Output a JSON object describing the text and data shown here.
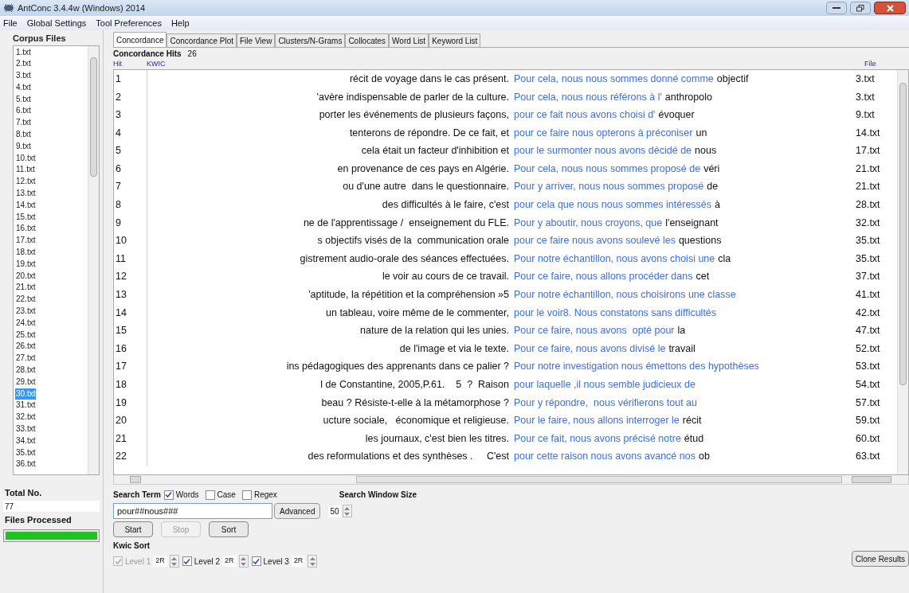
{
  "window": {
    "title": "AntConc 3.4.4w (Windows) 2014"
  },
  "menu": [
    "File",
    "Global Settings",
    "Tool Preferences",
    "Help"
  ],
  "corpus_files": {
    "title": "Corpus Files",
    "files": [
      {
        "name": "1.txt",
        "selected": false
      },
      {
        "name": "2.txt",
        "selected": false
      },
      {
        "name": "3.txt",
        "selected": false
      },
      {
        "name": "4.txt",
        "selected": false
      },
      {
        "name": "5.txt",
        "selected": false
      },
      {
        "name": "6.txt",
        "selected": false
      },
      {
        "name": "7.txt",
        "selected": false
      },
      {
        "name": "8.txt",
        "selected": false
      },
      {
        "name": "9.txt",
        "selected": false
      },
      {
        "name": "10.txt",
        "selected": false
      },
      {
        "name": "11.txt",
        "selected": false
      },
      {
        "name": "12.txt",
        "selected": false
      },
      {
        "name": "13.txt",
        "selected": false
      },
      {
        "name": "14.txt",
        "selected": false
      },
      {
        "name": "15.txt",
        "selected": false
      },
      {
        "name": "16.txt",
        "selected": false
      },
      {
        "name": "17.txt",
        "selected": false
      },
      {
        "name": "18.txt",
        "selected": false
      },
      {
        "name": "19.txt",
        "selected": false
      },
      {
        "name": "20.txt",
        "selected": false
      },
      {
        "name": "21.txt",
        "selected": false
      },
      {
        "name": "22.txt",
        "selected": false
      },
      {
        "name": "23.txt",
        "selected": false
      },
      {
        "name": "24.txt",
        "selected": false
      },
      {
        "name": "25.txt",
        "selected": false
      },
      {
        "name": "26.txt",
        "selected": false
      },
      {
        "name": "27.txt",
        "selected": false
      },
      {
        "name": "28.txt",
        "selected": false
      },
      {
        "name": "29.txt",
        "selected": false
      },
      {
        "name": "30.txt",
        "selected": true
      },
      {
        "name": "31.txt",
        "selected": false
      },
      {
        "name": "32.txt",
        "selected": false
      },
      {
        "name": "33.txt",
        "selected": false
      },
      {
        "name": "34.txt",
        "selected": false
      },
      {
        "name": "35.txt",
        "selected": false
      },
      {
        "name": "36.txt",
        "selected": false
      }
    ]
  },
  "total": {
    "label": "Total No.",
    "value": "77"
  },
  "files_processed": {
    "label": "Files Processed",
    "level": 1
  },
  "tabs": [
    {
      "label": "Concordance",
      "selected": true
    },
    {
      "label": "Concordance Plot",
      "selected": false
    },
    {
      "label": "File View",
      "selected": false
    },
    {
      "label": "Clusters/N-Grams",
      "selected": false
    },
    {
      "label": "Collocates",
      "selected": false
    },
    {
      "label": "Word List",
      "selected": false
    },
    {
      "label": "Keyword List",
      "selected": false
    }
  ],
  "concordance": {
    "hits_label": "Concordance Hits",
    "hits": "26",
    "columns": [
      "Hit",
      "KWIC",
      "File"
    ],
    "rows": [
      {
        "hit": "1",
        "left": "récit de voyage dans le cas présent.",
        "match": "Pour cela, nous nous sommes donné comme",
        "right": "objectif",
        "file": "3.txt"
      },
      {
        "hit": "2",
        "left": "'avère indispensable de parler de la culture.",
        "match": "Pour cela, nous nous référons à l'",
        "right": "anthropolo",
        "file": "3.txt"
      },
      {
        "hit": "3",
        "left": "porter les événements de plusieurs façons,",
        "match": "pour ce fait nous avons choisi d'",
        "right": "évoquer",
        "file": "9.txt"
      },
      {
        "hit": "4",
        "left": "tenterons de répondre. De ce fait, et",
        "match": "pour ce faire nous opterons à préconiser",
        "right": "un",
        "file": "14.txt"
      },
      {
        "hit": "5",
        "left": "cela était un facteur d'inhibition et",
        "match": "pour le surmonter nous avons décidé de",
        "right": "nous",
        "file": "17.txt"
      },
      {
        "hit": "6",
        "left": "en provenance de ces pays en Algérie.",
        "match": "Pour cela, nous nous sommes proposé de",
        "right": "véri",
        "file": "21.txt"
      },
      {
        "hit": "7",
        "left": "ou d'une autre  dans le questionnaire.",
        "match": "Pour y arriver, nous nous sommes proposé",
        "right": "de",
        "file": "21.txt"
      },
      {
        "hit": "8",
        "left": "des difficultés à le faire, c'est",
        "match": "pour cela que nous nous sommes intéressés",
        "right": "à",
        "file": "28.txt"
      },
      {
        "hit": "9",
        "left": "ne de l'apprentissage /  enseignement du FLE.",
        "match": "Pour y aboutir, nous croyons, que",
        "right": "l'enseignant",
        "file": "32.txt"
      },
      {
        "hit": "10",
        "left": "s objectifs visés de la  communication orale",
        "match": "pour ce faire nous avons soulevé les",
        "right": "questions",
        "file": "35.txt"
      },
      {
        "hit": "11",
        "left": "gistrement audio-orale des séances effectuées.",
        "match": "Pour notre échantillon, nous avons choisi une",
        "right": "cla",
        "file": "35.txt"
      },
      {
        "hit": "12",
        "left": "le voir au cours de ce travail.",
        "match": "Pour ce faire, nous allons procéder dans",
        "right": "cet",
        "file": "37.txt"
      },
      {
        "hit": "13",
        "left": "'aptitude, la répétition et la compréhension »5",
        "match": "Pour notre échantillon, nous choisirons une classe",
        "file": "41.txt"
      },
      {
        "hit": "14",
        "left": "un tableau, voire même de le commenter,",
        "match": "pour le voir8. Nous constatons sans difficultés",
        "file": "42.txt"
      },
      {
        "hit": "15",
        "left": "nature de la relation qui les unies.",
        "match": "Pour ce faire, nous avons  opté pour",
        "right": "la",
        "file": "47.txt"
      },
      {
        "hit": "16",
        "left": "de l'image et via le texte.",
        "match": "Pour ce faire, nous avons divisé le",
        "right": "travail",
        "file": "52.txt"
      },
      {
        "hit": "17",
        "left": "ins pédagogiques des apprenants dans ce palier ?",
        "match": "Pour notre investigation nous émettons des hypothèses",
        "file": "53.txt"
      },
      {
        "hit": "18",
        "left": "l de Constantine, 2005,P.61.    5  ?  Raison",
        "match": "pour laquelle ,il nous semble judicieux de",
        "file": "54.txt"
      },
      {
        "hit": "19",
        "left": "beau ? Résiste-t-elle à la métamorphose ?",
        "match": "Pour y répondre,  nous vérifierons tout au",
        "file": "57.txt"
      },
      {
        "hit": "20",
        "left": "ucture sociale,   économique et religieuse.",
        "match": "Pour le faire, nous allons interroger le",
        "right": "récit",
        "file": "59.txt"
      },
      {
        "hit": "21",
        "left": "les journaux, c'est bien les titres.",
        "match": "Pour ce fait, nous avons précisé notre",
        "right": "étud",
        "file": "60.txt"
      },
      {
        "hit": "22",
        "left": "des reformulations et des synthèses .     C'est",
        "match": "pour cette raison nous avons avancé nos",
        "right": "ob",
        "file": "63.txt"
      }
    ]
  },
  "search": {
    "label": "Search Term",
    "options": [
      {
        "label": "Words",
        "checked": true
      },
      {
        "label": "Case",
        "checked": false
      },
      {
        "label": "Regex",
        "checked": false
      }
    ],
    "value": "pour##nous###",
    "advanced": "Advanced",
    "window_size_label": "Search Window Size",
    "window_size": "50"
  },
  "buttons": [
    {
      "label": "Start",
      "disabled": false
    },
    {
      "label": "Stop",
      "disabled": true
    },
    {
      "label": "Sort",
      "disabled": false
    }
  ],
  "kwic_sort": {
    "label": "Kwic Sort",
    "levels": [
      {
        "label": "Level 1",
        "value": "2R",
        "checked": true,
        "disabled": true
      },
      {
        "label": "Level 2",
        "value": "2R",
        "checked": true,
        "disabled": false
      },
      {
        "label": "Level 3",
        "value": "2R",
        "checked": true,
        "disabled": false
      }
    ]
  },
  "clone_results": "Clone Results"
}
